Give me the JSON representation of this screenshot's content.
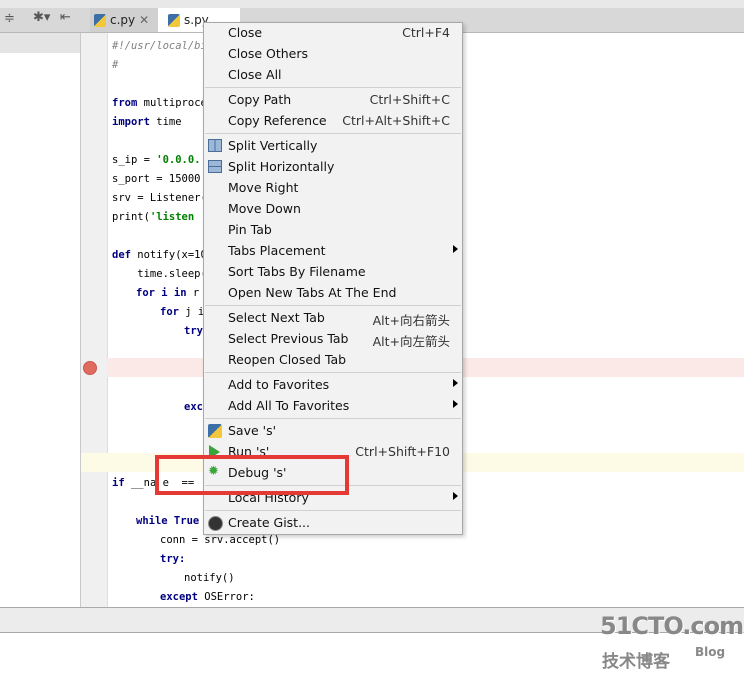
{
  "tabs": [
    {
      "label": "c.py"
    },
    {
      "label": "s.py"
    }
  ],
  "code": {
    "l1": "#!/usr/local/bi",
    "l2": "#",
    "l3a": "from",
    "l3b": " multiproce",
    "l4a": "import",
    "l4b": " time",
    "l5a": "s_ip = ",
    "l5b": "'0.0.0.",
    "l6": "s_port = 15000",
    "l7": "srv = Listener(",
    "l8a": "print(",
    "l8b": "'listen",
    "l9a": "def",
    "l9b": " notify(x=10",
    "l10": "    time.sleep(",
    "l11a": "for i in",
    "l11b": " r",
    "l12a": "for",
    "l12b": " j i",
    "l13": "try",
    "l14": "exc",
    "l15a": "if",
    "l15b": " __na e  ==",
    "l16a": "while True",
    "l16b": "",
    "l17": "conn = srv.accept()",
    "l18": "try:",
    "l19": "notify()",
    "l20a": "except",
    "l20b": " OSError:"
  },
  "menu": [
    {
      "label": "Close",
      "shortcut": "Ctrl+F4"
    },
    {
      "label": "Close Others"
    },
    {
      "label": "Close All"
    },
    {
      "label": "Copy Path",
      "shortcut": "Ctrl+Shift+C"
    },
    {
      "label": "Copy Reference",
      "shortcut": "Ctrl+Alt+Shift+C"
    },
    {
      "label": "Split Vertically",
      "icon": "split-vertical-icon"
    },
    {
      "label": "Split Horizontally",
      "icon": "split-horizontal-icon"
    },
    {
      "label": "Move Right"
    },
    {
      "label": "Move Down"
    },
    {
      "label": "Pin Tab"
    },
    {
      "label": "Tabs Placement",
      "submenu": true
    },
    {
      "label": "Sort Tabs By Filename"
    },
    {
      "label": "Open New Tabs At The End"
    },
    {
      "label": "Select Next Tab",
      "shortcut": "Alt+向右箭头"
    },
    {
      "label": "Select Previous Tab",
      "shortcut": "Alt+向左箭头"
    },
    {
      "label": "Reopen Closed Tab"
    },
    {
      "label": "Add to Favorites",
      "submenu": true
    },
    {
      "label": "Add All To Favorites",
      "submenu": true
    },
    {
      "label": "Save 's'",
      "icon": "python-icon"
    },
    {
      "label": "Run 's'",
      "shortcut": "Ctrl+Shift+F10",
      "icon": "run-icon"
    },
    {
      "label": "Debug 's'",
      "icon": "debug-bug-icon"
    },
    {
      "label": "Local History",
      "submenu": true
    },
    {
      "label": "Create Gist...",
      "icon": "github-icon"
    }
  ],
  "highlight_color": "#e53935",
  "watermark": {
    "text": "51CTO.com",
    "sub": "技术博客",
    "blog": "Blog"
  }
}
